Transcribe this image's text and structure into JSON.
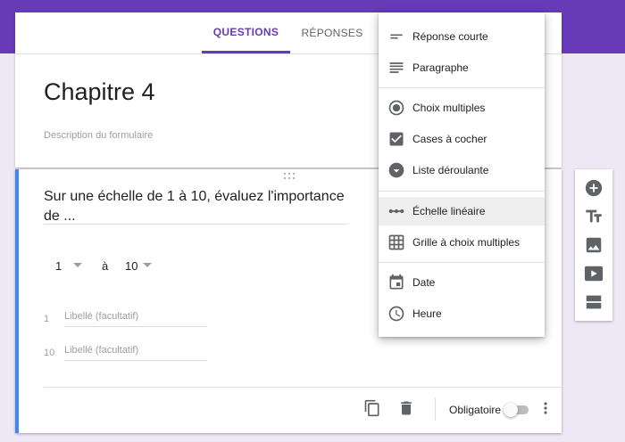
{
  "tabs": {
    "questions": "QUESTIONS",
    "responses": "RÉPONSES"
  },
  "form": {
    "title": "Chapitre 4",
    "description_placeholder": "Description du formulaire"
  },
  "question": {
    "text": "Sur une échelle de 1 à 10, évaluez l'importance de ...",
    "scale_min": "1",
    "scale_to": "à",
    "scale_max": "10",
    "labels": [
      {
        "num": "1",
        "placeholder": "Libellé (facultatif)"
      },
      {
        "num": "10",
        "placeholder": "Libellé (facultatif)"
      }
    ],
    "required_label": "Obligatoire",
    "required": false
  },
  "menu": {
    "items": [
      {
        "label": "Réponse courte",
        "icon": "short-answer-icon"
      },
      {
        "label": "Paragraphe",
        "icon": "paragraph-icon"
      },
      {
        "label": "Choix multiples",
        "icon": "radio-icon"
      },
      {
        "label": "Cases à cocher",
        "icon": "checkbox-icon"
      },
      {
        "label": "Liste déroulante",
        "icon": "dropdown-icon"
      },
      {
        "label": "Échelle linéaire",
        "icon": "linear-scale-icon",
        "selected": true
      },
      {
        "label": "Grille à choix multiples",
        "icon": "grid-icon"
      },
      {
        "label": "Date",
        "icon": "calendar-icon"
      },
      {
        "label": "Heure",
        "icon": "clock-icon"
      }
    ]
  },
  "colors": {
    "brand": "#673ab7",
    "accent_border": "#4285f4",
    "background": "#ede7f6"
  }
}
